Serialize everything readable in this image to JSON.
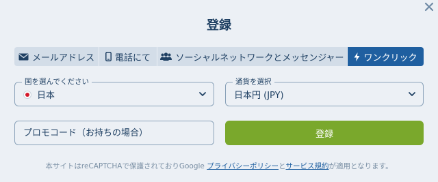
{
  "dialog": {
    "title": "登録",
    "close_icon": "close-icon"
  },
  "tabs": [
    {
      "label": "メールアドレス",
      "icon": "envelope-icon",
      "active": false
    },
    {
      "label": "電話にて",
      "icon": "phone-icon",
      "active": false
    },
    {
      "label": "ソーシャルネットワークとメッセンジャー",
      "icon": "users-icon",
      "active": false
    },
    {
      "label": "ワンクリック",
      "icon": "lightning-icon",
      "active": true
    }
  ],
  "country": {
    "label": "国を選んでください",
    "value": "日本",
    "icon": "japan-flag-icon"
  },
  "currency": {
    "label": "通貨を選択",
    "value": "日本円 (JPY)"
  },
  "promo": {
    "placeholder": "プロモコード（お持ちの場合）"
  },
  "submit": {
    "label": "登録"
  },
  "notice": {
    "prefix": "本サイトはreCAPTCHAで保護されておりGoogle ",
    "privacy_link": "プライバシーポリシー",
    "middle": "と",
    "terms_link": "サービス規約",
    "suffix": "が適用となります。"
  },
  "colors": {
    "background": "#ecf0f5",
    "tab_inactive": "#d3dde8",
    "tab_active": "#1f5fa0",
    "submit": "#7aa82c",
    "text": "#1f4063"
  }
}
